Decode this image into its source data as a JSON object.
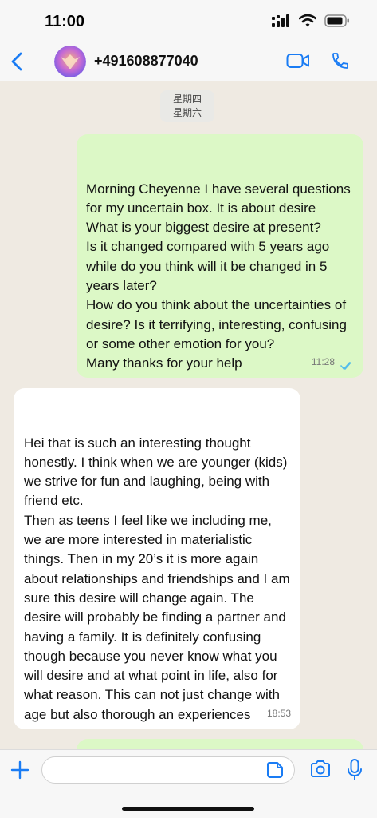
{
  "status_bar": {
    "time": "11:00"
  },
  "header": {
    "contact": "+491608877040"
  },
  "chat": {
    "day_separator": [
      "星期四",
      "星期六"
    ],
    "messages": [
      {
        "direction": "outgoing",
        "text": "Morning Cheyenne I have several questions for my uncertain box. It is about desire\nWhat is your biggest desire at present?\nIs it changed compared with 5 years ago while do you think will it be changed in 5 years later?\nHow do you think about the uncertainties of desire? Is it terrifying, interesting, confusing or some other emotion for you?\nMany thanks for your help",
        "time": "11:28"
      },
      {
        "direction": "incoming",
        "text": "Hei that is such an interesting thought honestly. I think when we are younger (kids) we strive for fun and laughing, being with friend etc.\nThen as teens I feel like we including me, we are more interested in materialistic things. Then in my 20’s it is more again about relationships and friendships and I am sure this desire will change again. The desire will probably be finding a partner and having a family. It is definitely confusing though because you never know what you will desire and at what point in life, also for what reason. This can not just change with age but also thorough an experiences",
        "time": "18:53"
      }
    ]
  },
  "input": {
    "placeholder": ""
  },
  "colors": {
    "accent": "#1a7cf4",
    "outgoing_bubble": "#dcf8c6",
    "incoming_bubble": "#ffffff",
    "read_ticks": "#53bdeb"
  }
}
